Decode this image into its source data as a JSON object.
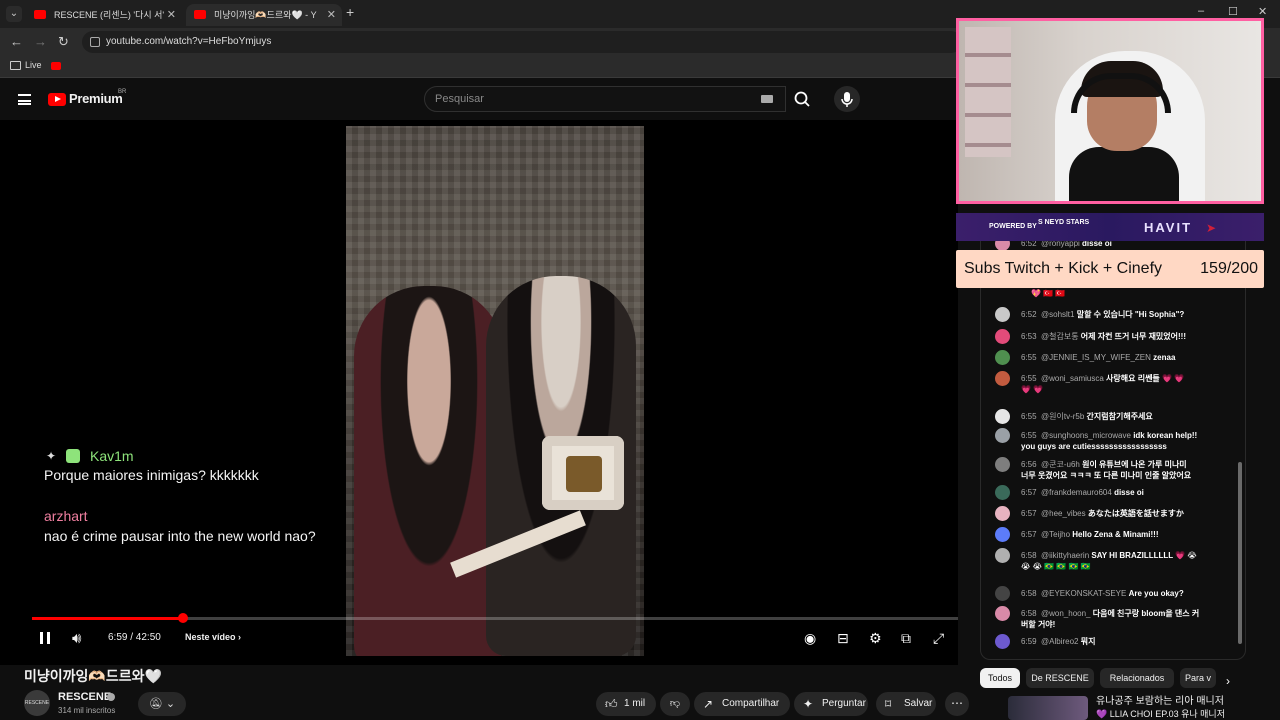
{
  "browser": {
    "tabs": [
      {
        "title": "RESCENE (리센느) '다시 서'"
      },
      {
        "title": "미냥이까잉🫶🏻드르와🤍 - Y"
      }
    ],
    "new_tab": "+",
    "url": "youtube.com/watch?v=HeFboYmjuys",
    "bookmarks": [
      {
        "label": "Live"
      }
    ],
    "window_controls": {
      "minimize": "–",
      "maximize": "☐",
      "close": "✕"
    }
  },
  "masthead": {
    "logo": "Premium",
    "region": "BR",
    "search_placeholder": "Pesquisar"
  },
  "player": {
    "overlay_chat": [
      {
        "user": "Kav1m",
        "message": "Porque maiores inimigas? kkkkkkk"
      },
      {
        "user": "arzhart",
        "message": "nao é crime pausar into the new world nao?"
      }
    ],
    "time": "6:59 / 42:50",
    "next_label": "Neste vídeo",
    "progress": 0.163
  },
  "video": {
    "title": "미냥이까잉🫶🏻드르와🤍",
    "channel": "RESCENE",
    "subscribers": "314 mil inscritos",
    "likes": "1 mil",
    "actions": {
      "share": "Compartilhar",
      "ask": "Perguntar",
      "save": "Salvar"
    }
  },
  "overlay": {
    "sponsor_powered": "POWERED BY",
    "sponsor_brand1": "S NEYD STARS",
    "sponsor_brand2": "HAVIT",
    "goal_label": "Subs Twitch + Kick + Cinefy",
    "goal_count": "159/200"
  },
  "chat": {
    "messages": [
      {
        "time": "6:52",
        "user": "@ronyappi",
        "text": "disse oi"
      },
      {
        "time": "",
        "user": "",
        "text": "💖 🇹🇷 🇹🇷"
      },
      {
        "time": "6:52",
        "user": "@sohslt1",
        "text": "말할 수 있습니다 \"Hi Sophia\"?"
      },
      {
        "time": "6:53",
        "user": "@철갑보통",
        "text": "어제 자컨 뜨거 너무 재밌었어!!!"
      },
      {
        "time": "6:55",
        "user": "@JENNIE_IS_MY_WIFE_ZEN",
        "text": "zenaa"
      },
      {
        "time": "6:55",
        "user": "@woni_samiusca",
        "text": "사랑해요 리쎈들 💗 💗",
        "text2": "💗 💗"
      },
      {
        "time": "6:55",
        "user": "@원이tv-r5b",
        "text": "간지럼참기해주세요"
      },
      {
        "time": "6:55",
        "user": "@sunghoons_microwave",
        "text": "idk korean help!!",
        "text2": "you guys are cutiesssssssssssssssss"
      },
      {
        "time": "6:56",
        "user": "@쿤코-u6h",
        "text": "원이 유튜브에 나온 가루 미나미",
        "text2": "너무 웃겼어요 ㅋㅋㅋ 또 다른 미나미 인줄 알았어요"
      },
      {
        "time": "6:57",
        "user": "@frankdemauro604",
        "text": "disse oi"
      },
      {
        "time": "6:57",
        "user": "@hee_vibes",
        "text": "あなたは英語を話せますか"
      },
      {
        "time": "6:57",
        "user": "@Teijho",
        "text": "Hello Zena & Minami!!!"
      },
      {
        "time": "6:58",
        "user": "@iikittyhaerin",
        "text": "SAY HI BRAZILLLLLL 💗 😭",
        "text2": "😭 😭 🇧🇷 🇧🇷 🇧🇷 🇧🇷"
      },
      {
        "time": "6:58",
        "user": "@EYEKONSKAT-SEYE",
        "text": "Are you okay?"
      },
      {
        "time": "6:58",
        "user": "@won_hoon_",
        "text": "다음에 친구랑 bloom을 댄스 커",
        "text2": "버할 거야!"
      },
      {
        "time": "6:59",
        "user": "@Albireo2",
        "text": "뭐지"
      }
    ],
    "chips": [
      "Todos",
      "De RESCENE",
      "Relacionados",
      "Para v"
    ],
    "related_title": "유나공주 보람하는 리아 매니저",
    "related_title2": "💜 LLIA CHOI EP.03 유나 매니저"
  },
  "colors": {
    "accent": "#ff0000",
    "webcam_border": "#ff5fa2",
    "goal_bg": "#ffd8c4",
    "sponsor_bg": "#2a1960"
  }
}
